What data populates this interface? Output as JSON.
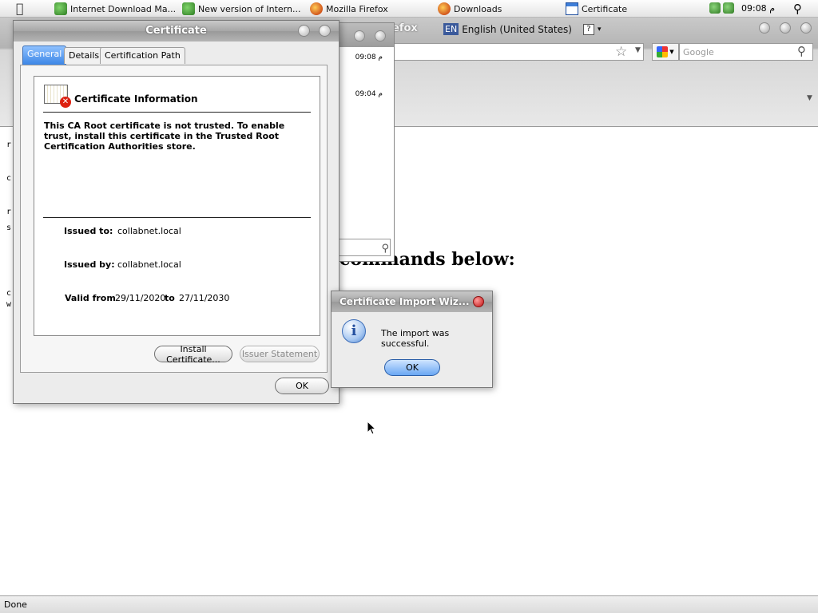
{
  "menubar": {
    "items": [
      {
        "label": "Internet Download Ma...",
        "icon": "idm-icon"
      },
      {
        "label": "New version of Intern...",
        "icon": "idm-icon"
      },
      {
        "label": "Mozilla Firefox",
        "icon": "firefox-icon"
      },
      {
        "label": "Downloads",
        "icon": "firefox-icon"
      },
      {
        "label": "Certificate",
        "icon": "window-icon"
      }
    ],
    "clock": "09:08 م"
  },
  "browser": {
    "title_fragment": "efox",
    "language": {
      "code": "EN",
      "name": "English (United States)",
      "help": "?"
    },
    "search_placeholder": "Google",
    "page_heading_fragment": "commands below:",
    "status": "Done",
    "left_fragments": [
      "r",
      "c",
      "r",
      "s",
      "c",
      "w"
    ]
  },
  "downloads": {
    "items": [
      {
        "time": "09:08 م"
      },
      {
        "time": "09:04 م"
      }
    ]
  },
  "certificate_dialog": {
    "title": "Certificate",
    "tabs": [
      "General",
      "Details",
      "Certification Path"
    ],
    "active_tab": "General",
    "info_heading": "Certificate Information",
    "warning": "This CA Root certificate is not trusted. To enable trust, install this certificate in the Trusted Root Certification Authorities store.",
    "issued_to_label": "Issued to:",
    "issued_to": "collabnet.local",
    "issued_by_label": "Issued by:",
    "issued_by": "collabnet.local",
    "valid_from_label": "Valid from",
    "valid_from": "29/11/2020",
    "valid_to_label": "to",
    "valid_to": "27/11/2030",
    "install_button": "Install Certificate...",
    "issuer_statement_button": "Issuer Statement",
    "ok_button": "OK"
  },
  "import_wizard": {
    "title": "Certificate Import Wiz...",
    "message": "The import was successful.",
    "ok_button": "OK"
  }
}
